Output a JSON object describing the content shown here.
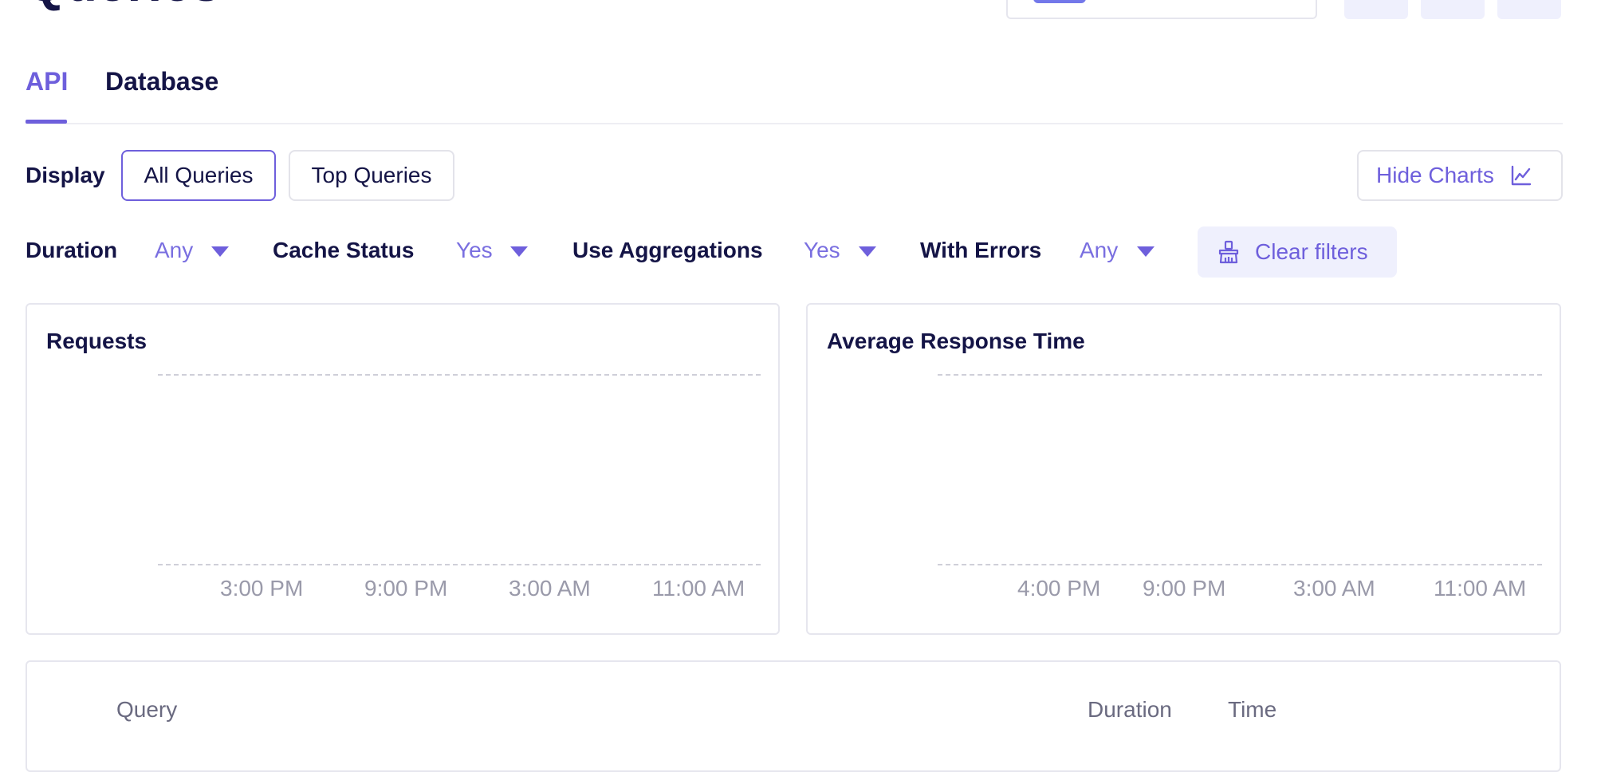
{
  "page": {
    "title": "Queries"
  },
  "tabs": [
    {
      "label": "API",
      "active": true
    },
    {
      "label": "Database",
      "active": false
    }
  ],
  "display": {
    "label": "Display",
    "options": [
      {
        "label": "All Queries",
        "selected": true
      },
      {
        "label": "Top Queries",
        "selected": false
      }
    ],
    "hide_charts_label": "Hide Charts",
    "hide_charts_icon": "line-chart-icon"
  },
  "filters": [
    {
      "label": "Duration",
      "value": "Any"
    },
    {
      "label": "Cache Status",
      "value": "Yes"
    },
    {
      "label": "Use Aggregations",
      "value": "Yes"
    },
    {
      "label": "With Errors",
      "value": "Any"
    }
  ],
  "clear_filters": {
    "label": "Clear filters",
    "icon": "broom-icon"
  },
  "colors": {
    "accent": "#6e5fdc",
    "text": "#141446",
    "muted": "#9a9aaa"
  },
  "charts": [
    {
      "title": "Requests",
      "x_ticks": [
        "3:00 PM",
        "9:00 PM",
        "3:00 AM",
        "11:00 AM"
      ]
    },
    {
      "title": "Average Response Time",
      "x_ticks": [
        "4:00 PM",
        "9:00 PM",
        "3:00 AM",
        "11:00 AM"
      ]
    }
  ],
  "table": {
    "columns": [
      "Query",
      "Duration",
      "Time"
    ]
  }
}
